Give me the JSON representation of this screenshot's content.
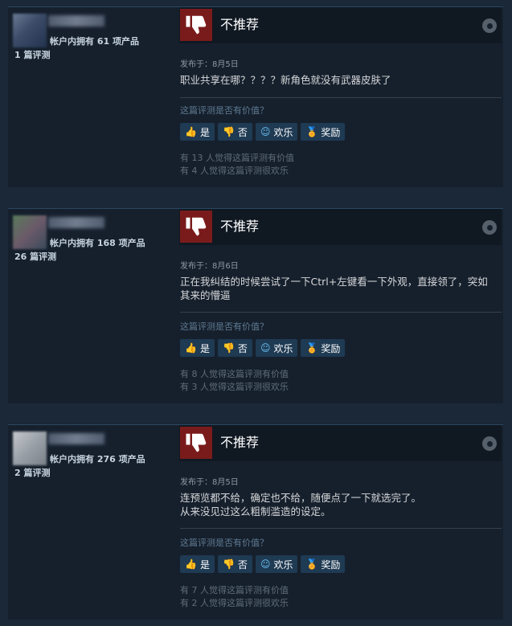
{
  "reviews": [
    {
      "products_owned": "帐户内拥有 61 项产品",
      "review_count": "1 篇评测",
      "recommendation": "不推荐",
      "posted": "发布于：8月5日",
      "content": "职业共享在哪？？？？新角色就没有武器皮肤了",
      "helpful_question": "这篇评测是否有价值？",
      "buttons": {
        "yes": "是",
        "no": "否",
        "funny": "欢乐",
        "award": "奖励"
      },
      "found_helpful": "有 13 人觉得这篇评测有价值",
      "found_funny": "有 4 人觉得这篇评测很欢乐"
    },
    {
      "products_owned": "帐户内拥有 168 项产品",
      "review_count": "26 篇评测",
      "recommendation": "不推荐",
      "posted": "发布于：8月6日",
      "content": "正在我纠结的时候尝试了一下Ctrl+左键看一下外观，直接领了，突如其来的懵逼",
      "helpful_question": "这篇评测是否有价值？",
      "buttons": {
        "yes": "是",
        "no": "否",
        "funny": "欢乐",
        "award": "奖励"
      },
      "found_helpful": "有 8 人觉得这篇评测有价值",
      "found_funny": "有 3 人觉得这篇评测很欢乐"
    },
    {
      "products_owned": "帐户内拥有 276 项产品",
      "review_count": "2 篇评测",
      "recommendation": "不推荐",
      "posted": "发布于：8月5日",
      "content_line1": "连预览都不给，确定也不给，随便点了一下就选完了。",
      "content_line2": "从来没见过这么粗制滥造的设定。",
      "helpful_question": "这篇评测是否有价值？",
      "buttons": {
        "yes": "是",
        "no": "否",
        "funny": "欢乐",
        "award": "奖励"
      },
      "found_helpful": "有 7 人觉得这篇评测有价值",
      "found_funny": "有 2 人觉得这篇评测很欢乐"
    }
  ],
  "icons": {
    "thumb": "thumbs-down-icon",
    "steam": "steam-logo-icon",
    "yes": "thumbs-up-icon",
    "no": "thumbs-down-icon",
    "funny": "smiley-icon",
    "award": "award-ribbon-icon"
  },
  "colors": {
    "background": "#1b2838",
    "card": "#16202d",
    "not_recommended": "#7a1b1b",
    "button": "#1f3a53",
    "link_blue": "#67c1f5"
  }
}
